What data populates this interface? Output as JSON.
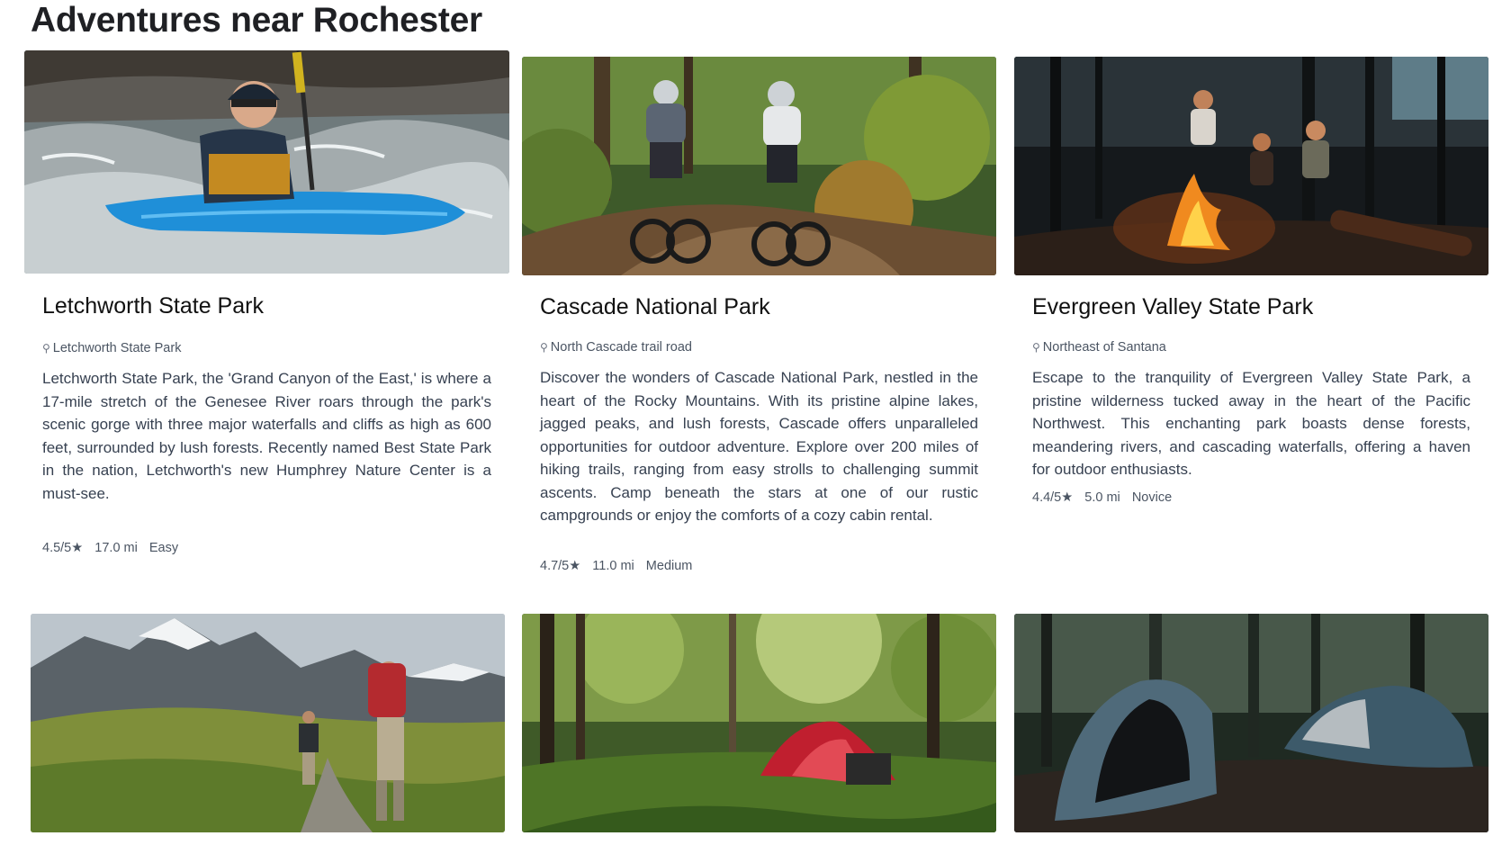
{
  "page": {
    "title": "Adventures near Rochester"
  },
  "cards": [
    {
      "title": "Letchworth State Park",
      "location": "Letchworth State Park",
      "description": "Letchworth State Park, the 'Grand Canyon of the East,' is where a 17-mile stretch of the Genesee River roars through the park's scenic gorge with three major waterfalls and cliffs as high as 600 feet, surrounded by lush forests. Recently named Best State Park in the nation, Letchworth's new Humphrey Nature Center is a must-see.",
      "rating": "4.5/5★",
      "distance": "17.0 mi",
      "difficulty": "Easy",
      "image": "kayaker-in-whitewater"
    },
    {
      "title": "Cascade National Park",
      "location": "North Cascade trail road",
      "description": "Discover the wonders of Cascade National Park, nestled in the heart of the Rocky Mountains. With its pristine alpine lakes, jagged peaks, and lush forests, Cascade offers unparalleled opportunities for outdoor adventure. Explore over 200 miles of hiking trails, ranging from easy strolls to challenging summit ascents. Camp beneath the stars at one of our rustic campgrounds or enjoy the comforts of a cozy cabin rental.",
      "rating": "4.7/5★",
      "distance": "11.0 mi",
      "difficulty": "Medium",
      "image": "mountain-bikers-on-forest-trail"
    },
    {
      "title": "Evergreen Valley State Park",
      "location": "Northeast of Santana",
      "description": "Escape to the tranquility of Evergreen Valley State Park, a pristine wilderness tucked away in the heart of the Pacific Northwest. This enchanting park boasts dense forests, meandering rivers, and cascading waterfalls, offering a haven for outdoor enthusiasts.",
      "rating": "4.4/5★",
      "distance": "5.0 mi",
      "difficulty": "Novice",
      "image": "campfire-in-forest"
    },
    {
      "image": "hikers-in-mountains"
    },
    {
      "image": "red-tent-in-forest"
    },
    {
      "image": "tents-in-misty-forest"
    }
  ]
}
